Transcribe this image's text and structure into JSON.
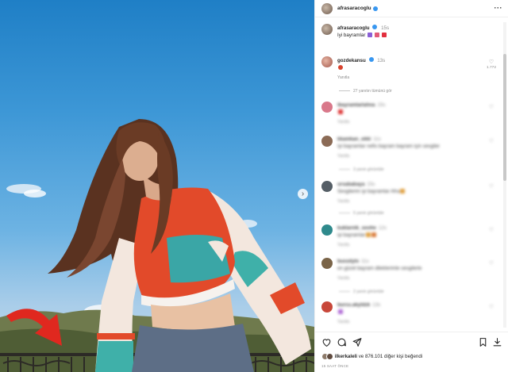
{
  "post": {
    "author": "afrasaracoglu",
    "author_verified": true,
    "more_icon": "more-horizontal-icon",
    "next_icon": "chevron-right-icon"
  },
  "caption": {
    "author": "afrasaracoglu",
    "time": "15s",
    "text": "Iyi bayramlar"
  },
  "comments": [
    {
      "user": "gozdekansu",
      "time": "13s",
      "text": "",
      "reply_label": "Yanıtla",
      "likes": "1.772",
      "blurred": false
    },
    {
      "view_replies": "27 yanıtın tümünü gör"
    },
    {
      "user": "ibayramlarlahna",
      "time": "15s",
      "text": "",
      "reply_label": "Yanıtla",
      "likes": "",
      "blurred": true
    },
    {
      "user": "kkamkan_okki",
      "time": "11s",
      "text": "Iyi bayramlar nefis bayram bayram için sevgiler",
      "reply_label": "Yanıtla",
      "likes": "",
      "blurred": true,
      "replies": "3 yanıtı görüntüle"
    },
    {
      "user": "ursababaya",
      "time": "15s",
      "text": "Sevgilerim iyi bayramlar Afra",
      "reply_label": "Yanıtla",
      "likes": "",
      "blurred": true,
      "replies": "5 yanıtı görüntüle"
    },
    {
      "user": "kuklarnik_soohe",
      "time": "12s",
      "text": "iyi bayramlar",
      "reply_label": "Yanıtla",
      "likes": "",
      "blurred": true
    },
    {
      "user": "buozdylo",
      "time": "11s",
      "text": "en güzel bayram dileklerimle sevgilerle",
      "reply_label": "Yanıtla",
      "likes": "",
      "blurred": true,
      "replies": "2 yanıtı görüntüle"
    },
    {
      "user": "burcu.akyldzk",
      "time": "13s",
      "text": "",
      "reply_label": "Yanıtla",
      "likes": "",
      "blurred": true
    }
  ],
  "footer": {
    "likes_prefix": "ilkerkaleli",
    "likes_suffix": "ve 876.101 diğer kişi beğendi",
    "time_ago": "15 SAAT ÖNCE"
  },
  "colors": {
    "verified": "#3897f0",
    "sky_top": "#1f7fc6",
    "sky_bottom": "#c7dcea",
    "arrow": "#e0281f",
    "sweater_orange": "#e24a2a",
    "sweater_teal": "#3aa6a6"
  }
}
